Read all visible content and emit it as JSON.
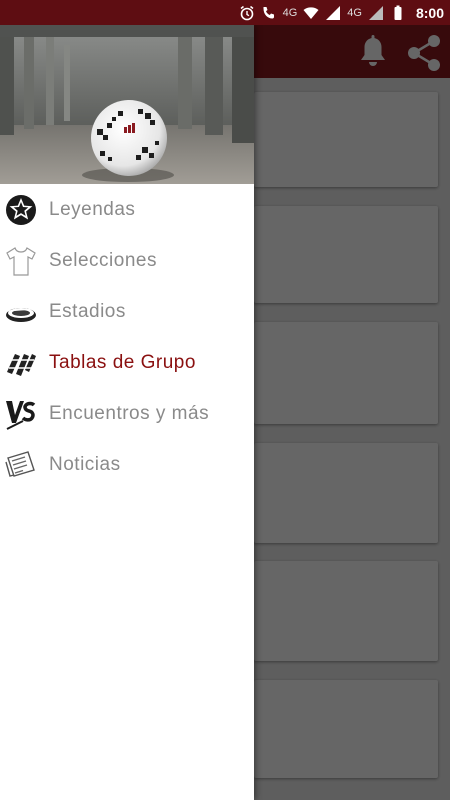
{
  "status_bar": {
    "network_label": "4G",
    "network_label_small": "4G",
    "time": "8:00"
  },
  "app_bar": {
    "actions": [
      "bell-icon",
      "share-icon"
    ]
  },
  "colors": {
    "status_bar": "#5e0d12",
    "app_bar": "#8a1a20",
    "active_item": "#8a1010",
    "inactive_item": "#8a8a8a"
  },
  "drawer": {
    "header_image": "adidas-telstar-soccer-ball",
    "items": [
      {
        "label": "Leyendas",
        "icon": "star-badge-icon",
        "active": false
      },
      {
        "label": "Selecciones",
        "icon": "shirt-icon",
        "active": false
      },
      {
        "label": "Estadios",
        "icon": "stadium-icon",
        "active": false
      },
      {
        "label": "Tablas de Grupo",
        "icon": "group-table-icon",
        "active": true
      },
      {
        "label": "Encuentros y más",
        "icon": "versus-icon",
        "active": false
      },
      {
        "label": "Noticias",
        "icon": "newspaper-icon",
        "active": false
      }
    ]
  }
}
